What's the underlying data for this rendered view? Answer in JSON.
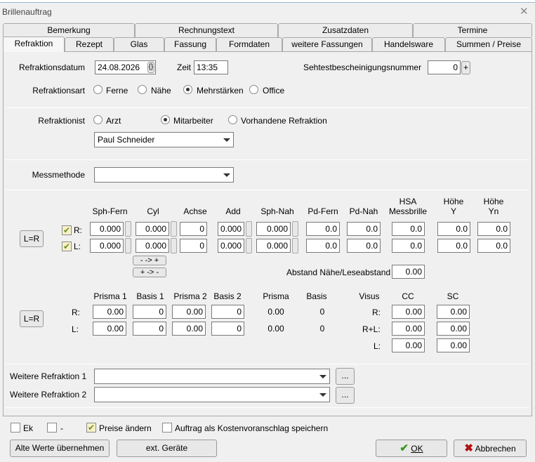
{
  "window": {
    "title": "Brillenauftrag"
  },
  "tabs_top": [
    "Bemerkung",
    "Rechnungstext",
    "Zusatzdaten",
    "Termine"
  ],
  "tabs_bottom": [
    "Refraktion",
    "Rezept",
    "Glas",
    "Fassung",
    "Formdaten",
    "weitere Fassungen",
    "Handelsware",
    "Summen / Preise"
  ],
  "date": {
    "label": "Refraktionsdatum",
    "value": "24.08.2026",
    "picker": "{}"
  },
  "time": {
    "label": "Zeit",
    "value": "13:35"
  },
  "seh": {
    "label": "Sehtestbescheinigungsnummer",
    "value": "0",
    "plus": "+"
  },
  "refrart": {
    "label": "Refraktionsart",
    "options": [
      "Ferne",
      "Nähe",
      "Mehrstärken",
      "Office"
    ]
  },
  "refraktionist": {
    "label": "Refraktionist",
    "options": [
      "Arzt",
      "Mitarbeiter",
      "Vorhandene Refraktion"
    ],
    "selected_person": "Paul Schneider"
  },
  "messmethode": {
    "label": "Messmethode",
    "value": ""
  },
  "lr_button": "L=R",
  "rl": {
    "r": "R:",
    "l": "L:"
  },
  "cols": [
    "Sph-Fern",
    "Cyl",
    "Achse",
    "Add",
    "Sph-Nah",
    "Pd-Fern",
    "Pd-Nah",
    "HSA",
    "Messbrille",
    "Höhe",
    "Y",
    "Höhe",
    "Yn"
  ],
  "rows": {
    "r": [
      "0.000",
      "0.000",
      "0",
      "0.000",
      "0.000",
      "0.0",
      "0.0",
      "0.0",
      "0.0",
      "0.0"
    ],
    "l": [
      "0.000",
      "0.000",
      "0",
      "0.000",
      "0.000",
      "0.0",
      "0.0",
      "0.0",
      "0.0",
      "0.0"
    ]
  },
  "arrows": [
    "- -> +",
    "+ -> -"
  ],
  "abstand": {
    "label": "Abstand Nähe/Leseabstand",
    "value": "0.00"
  },
  "prisma_cols": [
    "Prisma 1",
    "Basis 1",
    "Prisma 2",
    "Basis 2",
    "Prisma",
    "Basis",
    "Visus",
    "CC",
    "SC"
  ],
  "prisma_r": [
    "0.00",
    "0",
    "0.00",
    "0",
    "0.00",
    "0"
  ],
  "prisma_l": [
    "0.00",
    "0",
    "0.00",
    "0",
    "0.00",
    "0"
  ],
  "visus": {
    "r": "R:",
    "rl": "R+L:",
    "l": "L:",
    "cc": [
      "0.00",
      "0.00",
      "0.00"
    ],
    "sc": [
      "0.00",
      "0.00",
      "0.00"
    ]
  },
  "weitere": [
    {
      "label": "Weitere Refraktion 1",
      "dots": "..."
    },
    {
      "label": "Weitere Refraktion 2",
      "dots": "..."
    }
  ],
  "footer_checks": [
    {
      "label": "Ek",
      "checked": false
    },
    {
      "label": "-",
      "checked": false
    },
    {
      "label": "Preise ändern",
      "checked": true
    },
    {
      "label": "Auftrag als Kostenvoranschlag speichern",
      "checked": false
    }
  ],
  "buttons": {
    "alte": "Alte Werte übernehmen",
    "ext": "ext. Geräte",
    "ok": "OK",
    "cancel": "Abbrechen"
  }
}
